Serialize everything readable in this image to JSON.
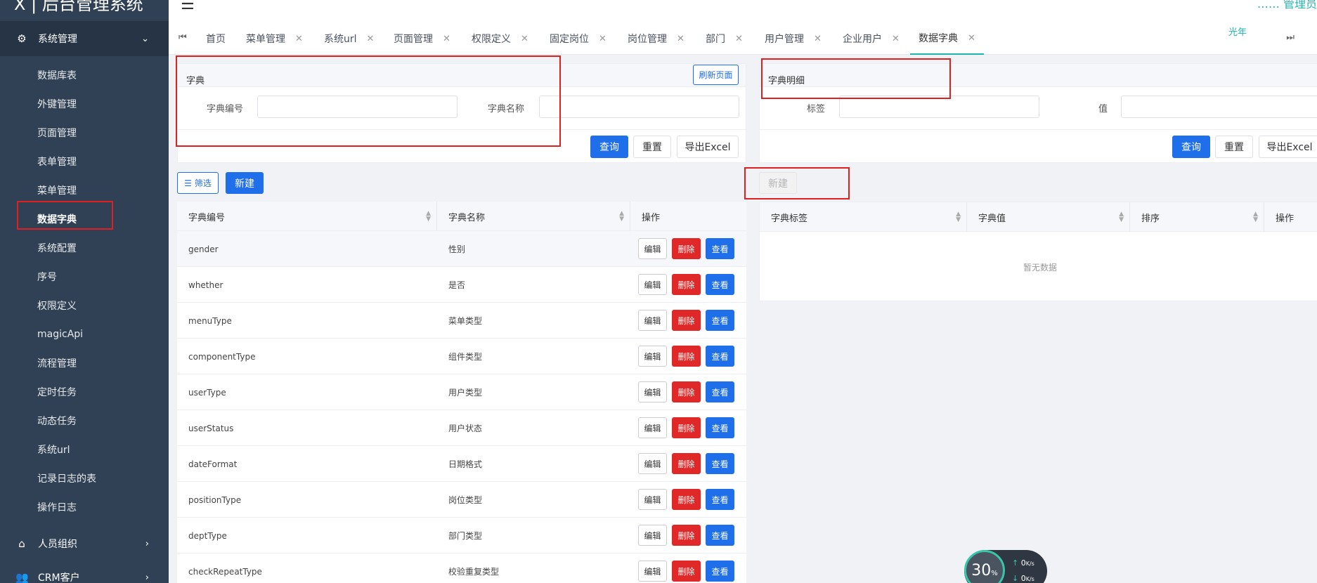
{
  "app": {
    "logo_text": "X | 后台管理系统",
    "topbar_right": "…… 管理员"
  },
  "sidebar": {
    "group_system": "系统管理",
    "items": [
      "数据库表",
      "外键管理",
      "页面管理",
      "表单管理",
      "菜单管理",
      "数据字典",
      "系统配置",
      "序号",
      "权限定义",
      "magicApi",
      "流程管理",
      "定时任务",
      "动态任务",
      "系统url",
      "记录日志的表",
      "操作日志"
    ],
    "active_item": "数据字典",
    "group_people": "人员组织",
    "group_crm": "CRM客户"
  },
  "tabs": [
    {
      "label": "首页",
      "closable": false
    },
    {
      "label": "菜单管理",
      "closable": true
    },
    {
      "label": "系统url",
      "closable": true
    },
    {
      "label": "页面管理",
      "closable": true
    },
    {
      "label": "权限定义",
      "closable": true
    },
    {
      "label": "固定岗位",
      "closable": true
    },
    {
      "label": "岗位管理",
      "closable": true
    },
    {
      "label": "部门",
      "closable": true
    },
    {
      "label": "用户管理",
      "closable": true
    },
    {
      "label": "企业用户",
      "closable": true
    },
    {
      "label": "数据字典",
      "closable": true,
      "active": true
    }
  ],
  "tab_user_note": "光年",
  "dict_panel": {
    "title": "字典",
    "refresh_label": "刷新页面",
    "code_label": "字典编号",
    "name_label": "字典名称",
    "code_value": "",
    "name_value": "",
    "query_label": "查询",
    "reset_label": "重置",
    "export_label": "导出Excel",
    "filter_label": "筛选",
    "new_label": "新建"
  },
  "detail_panel": {
    "title": "字典明细",
    "tag_label": "标签",
    "value_label": "值",
    "tag_value": "",
    "value_value": "",
    "query_label": "查询",
    "reset_label": "重置",
    "export_label": "导出Excel",
    "new_label": "新建"
  },
  "dict_table": {
    "columns": [
      "字典编号",
      "字典名称",
      "操作"
    ],
    "rows": [
      {
        "code": "gender",
        "name": "性别"
      },
      {
        "code": "whether",
        "name": "是否"
      },
      {
        "code": "menuType",
        "name": "菜单类型"
      },
      {
        "code": "componentType",
        "name": "组件类型"
      },
      {
        "code": "userType",
        "name": "用户类型"
      },
      {
        "code": "userStatus",
        "name": "用户状态"
      },
      {
        "code": "dateFormat",
        "name": "日期格式"
      },
      {
        "code": "positionType",
        "name": "岗位类型"
      },
      {
        "code": "deptType",
        "name": "部门类型"
      },
      {
        "code": "checkRepeatType",
        "name": "校验重复类型"
      }
    ],
    "edit_label": "编辑",
    "delete_label": "删除",
    "view_label": "查看"
  },
  "detail_table": {
    "columns": [
      "字典标签",
      "字典值",
      "排序",
      "操作"
    ],
    "empty_text": "暂无数据"
  },
  "speed_widget": {
    "percent": "30",
    "percent_unit": "%",
    "up": "0",
    "down": "0",
    "unit": "K/s"
  },
  "colors": {
    "primary": "#1f6eea",
    "danger": "#e02828",
    "sidebar": "#304156",
    "accent": "#1fb5ac",
    "highlight": "#e02020"
  }
}
